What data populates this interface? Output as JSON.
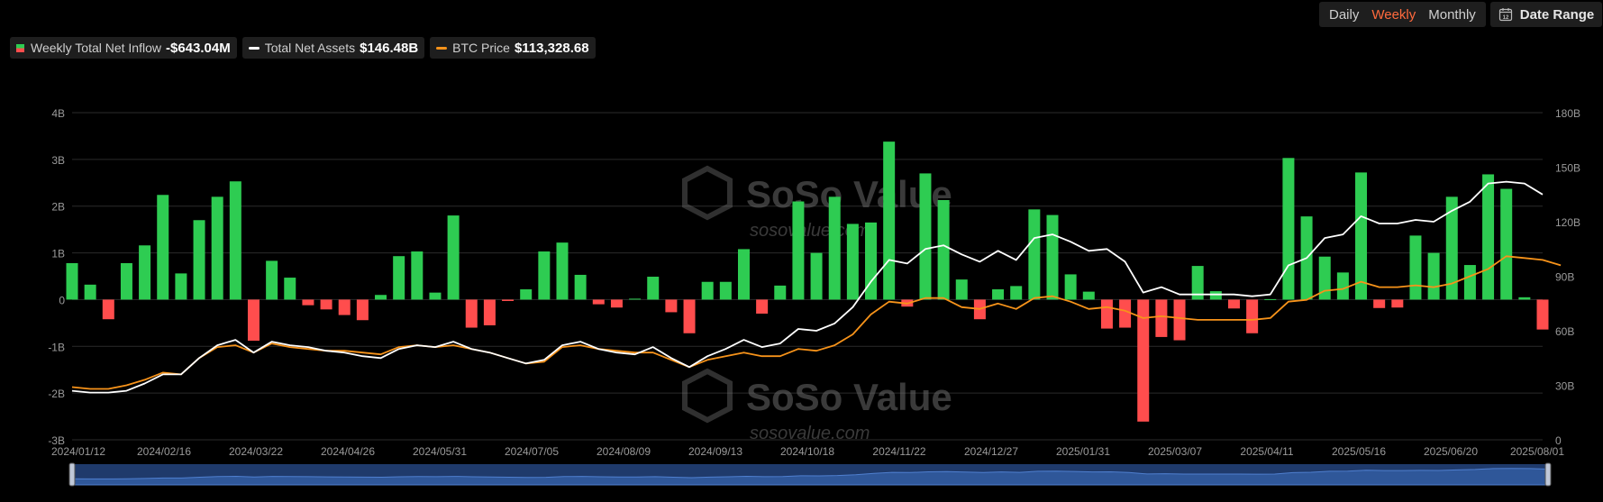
{
  "legend": {
    "inflow": {
      "label": "Weekly Total Net Inflow",
      "value": "-$643.04M",
      "color": "#2ecc52",
      "neg_color": "#ff4d4d"
    },
    "assets": {
      "label": "Total Net Assets",
      "value": "$146.48B",
      "color": "#ffffff"
    },
    "btc": {
      "label": "BTC Price",
      "value": "$113,328.68",
      "color": "#f7931a"
    }
  },
  "periods": [
    {
      "label": "Daily",
      "active": false
    },
    {
      "label": "Weekly",
      "active": true
    },
    {
      "label": "Monthly",
      "active": false
    }
  ],
  "date_range": {
    "label": "Date Range",
    "icon": "calendar-icon",
    "icon_text": "12"
  },
  "watermark": {
    "brand": "SoSo Value",
    "site": "sosovalue.com"
  },
  "chart_data": {
    "type": "bar",
    "x_tick_labels": [
      "2024/01/12",
      "2024/02/16",
      "2024/03/22",
      "2024/04/26",
      "2024/05/31",
      "2024/07/05",
      "2024/08/09",
      "2024/09/13",
      "2024/10/18",
      "2024/11/22",
      "2024/12/27",
      "2025/01/31",
      "2025/03/07",
      "2025/04/11",
      "2025/05/16",
      "2025/06/20",
      "2025/08/01"
    ],
    "y_left": {
      "ticks": [
        "4B",
        "3B",
        "2B",
        "1B",
        "0",
        "-1B",
        "-2B",
        "-3B"
      ],
      "range": [
        -3,
        4
      ],
      "unit": "B"
    },
    "y_right": {
      "ticks": [
        "180B",
        "150B",
        "120B",
        "90B",
        "60B",
        "30B",
        "0"
      ],
      "range": [
        0,
        180
      ],
      "unit": "B"
    },
    "grid": true,
    "weeks_count": 82,
    "series": [
      {
        "name": "Weekly Total Net Inflow",
        "type": "bar",
        "axis": "left",
        "values": [
          0.78,
          0.32,
          -0.42,
          0.78,
          1.16,
          2.24,
          0.56,
          1.7,
          2.2,
          2.53,
          -0.88,
          0.83,
          0.47,
          -0.12,
          -0.21,
          -0.33,
          -0.44,
          0.1,
          0.93,
          1.03,
          0.15,
          1.8,
          -0.6,
          -0.55,
          -0.03,
          0.22,
          1.03,
          1.22,
          0.53,
          -0.1,
          -0.17,
          0.02,
          0.49,
          -0.27,
          -0.72,
          0.38,
          0.38,
          1.08,
          -0.3,
          0.3,
          2.1,
          1.0,
          2.2,
          1.62,
          1.65,
          3.38,
          -0.15,
          2.7,
          2.13,
          0.43,
          -0.42,
          0.22,
          0.29,
          1.93,
          1.81,
          0.54,
          0.17,
          -0.62,
          -0.6,
          -2.61,
          -0.8,
          -0.87,
          0.72,
          0.18,
          -0.19,
          -0.72,
          0.01,
          3.03,
          1.78,
          0.92,
          0.58,
          2.72,
          -0.18,
          -0.17,
          1.37,
          1.0,
          2.2,
          0.74,
          2.68,
          2.37,
          0.05,
          -0.64
        ]
      },
      {
        "name": "Total Net Assets",
        "type": "line",
        "axis": "right",
        "values": [
          27,
          26,
          26,
          27,
          31,
          36,
          36,
          45,
          52,
          55,
          48,
          54,
          52,
          51,
          49,
          48,
          46,
          45,
          50,
          52,
          51,
          54,
          50,
          48,
          45,
          42,
          44,
          52,
          54,
          50,
          48,
          47,
          51,
          45,
          40,
          46,
          50,
          55,
          51,
          53,
          61,
          60,
          64,
          73,
          87,
          99,
          97,
          105,
          107,
          102,
          98,
          104,
          99,
          111,
          113,
          109,
          104,
          105,
          98,
          81,
          84,
          80,
          80,
          80,
          80,
          79,
          80,
          96,
          100,
          111,
          113,
          123,
          119,
          119,
          121,
          120,
          126,
          131,
          141,
          142,
          141,
          135
        ]
      },
      {
        "name": "BTC Price",
        "type": "line",
        "axis": "right",
        "values": [
          29,
          28,
          28,
          30,
          33,
          37,
          36,
          45,
          51,
          52,
          48,
          53,
          51,
          50,
          49,
          49,
          48,
          47,
          51,
          52,
          51,
          52,
          50,
          48,
          45,
          42,
          43,
          51,
          52,
          50,
          49,
          48,
          48,
          44,
          40,
          44,
          46,
          48,
          46,
          46,
          50,
          49,
          52,
          58,
          69,
          76,
          75,
          78,
          78,
          73,
          72,
          75,
          72,
          78,
          79,
          76,
          72,
          73,
          71,
          67,
          68,
          67,
          66,
          66,
          66,
          66,
          67,
          76,
          77,
          82,
          83,
          87,
          84,
          84,
          85,
          84,
          86,
          90,
          94,
          101,
          100,
          99,
          96
        ]
      }
    ],
    "navigator": true
  }
}
